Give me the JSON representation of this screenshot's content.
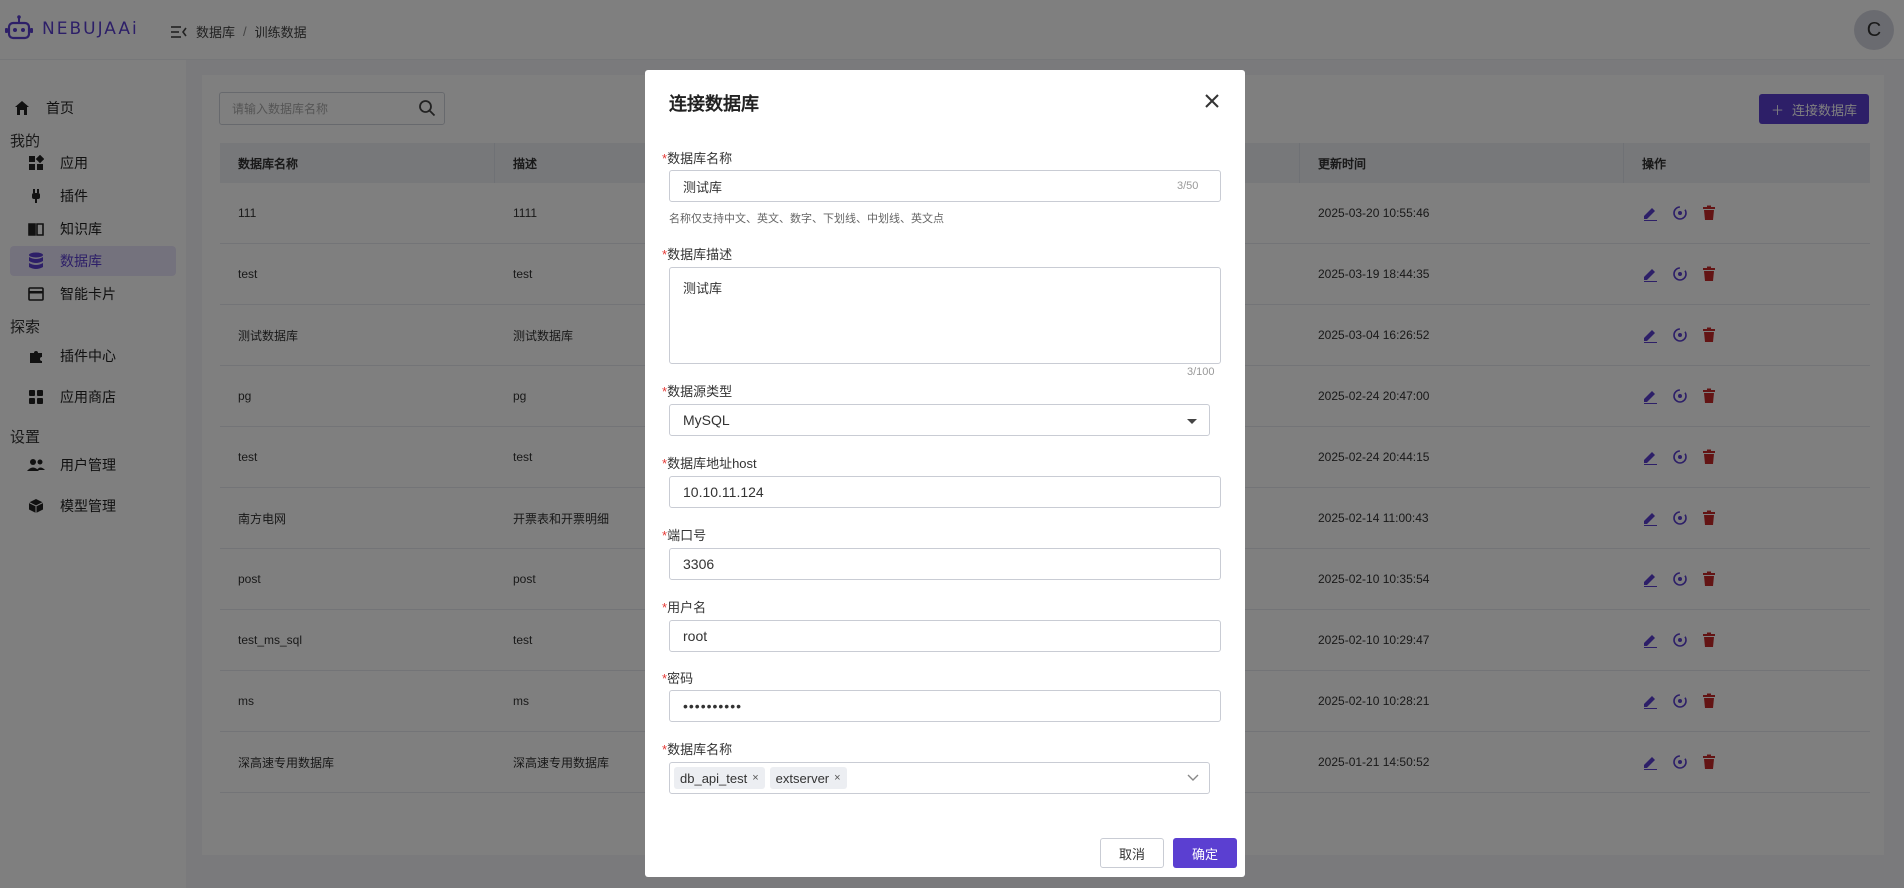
{
  "header": {
    "logo_text": "NEBUJAAi",
    "breadcrumb": [
      "数据库",
      "训练数据"
    ],
    "breadcrumb_sep": "/",
    "avatar_letter": "C"
  },
  "sidebar": {
    "home": "首页",
    "group_mine": "我的",
    "mine_items": [
      "应用",
      "插件",
      "知识库",
      "数据库",
      "智能卡片"
    ],
    "group_explore": "探索",
    "explore_items": [
      "插件中心",
      "应用商店"
    ],
    "group_settings": "设置",
    "settings_items": [
      "用户管理",
      "模型管理"
    ],
    "active": "数据库"
  },
  "main": {
    "search_placeholder": "请输入数据库名称",
    "connect_button": "连接数据库",
    "columns": [
      "数据库名称",
      "描述",
      "更新时间",
      "操作"
    ],
    "rows": [
      [
        "111",
        "1111",
        "2025-03-20 10:55:46"
      ],
      [
        "test",
        "test",
        "2025-03-19 18:44:35"
      ],
      [
        "测试数据库",
        "测试数据库",
        "2025-03-04 16:26:52"
      ],
      [
        "pg",
        "pg",
        "2025-02-24 20:47:00"
      ],
      [
        "test",
        "test",
        "2025-02-24 20:44:15"
      ],
      [
        "南方电网",
        "开票表和开票明细",
        "2025-02-14 11:00:43"
      ],
      [
        "post",
        "post",
        "2025-02-10 10:35:54"
      ],
      [
        "test_ms_sql",
        "test",
        "2025-02-10 10:29:47"
      ],
      [
        "ms",
        "ms",
        "2025-02-10 10:28:21"
      ],
      [
        "深高速专用数据库",
        "深高速专用数据库",
        "2025-01-21 14:50:52"
      ]
    ]
  },
  "modal": {
    "title": "连接数据库",
    "required_mark": "*",
    "name_label": "数据库名称",
    "name_value": "测试库",
    "name_counter": "3/50",
    "name_hint": "名称仅支持中文、英文、数字、下划线、中划线、英文点",
    "desc_label": "数据库描述",
    "desc_value": "测试库",
    "desc_counter": "3/100",
    "type_label": "数据源类型",
    "type_value": "MySQL",
    "host_label": "数据库地址host",
    "host_value": "10.10.11.124",
    "port_label": "端口号",
    "port_value": "3306",
    "user_label": "用户名",
    "user_value": "root",
    "password_label": "密码",
    "password_value": "••••••••••",
    "dbname_label": "数据库名称",
    "dbname_tags": [
      "db_api_test",
      "extserver"
    ],
    "tag_remove": "×",
    "cancel": "取消",
    "ok": "确定"
  },
  "colors": {
    "accent": "#5b3fd1",
    "danger": "#c62828",
    "required": "#e53935"
  }
}
